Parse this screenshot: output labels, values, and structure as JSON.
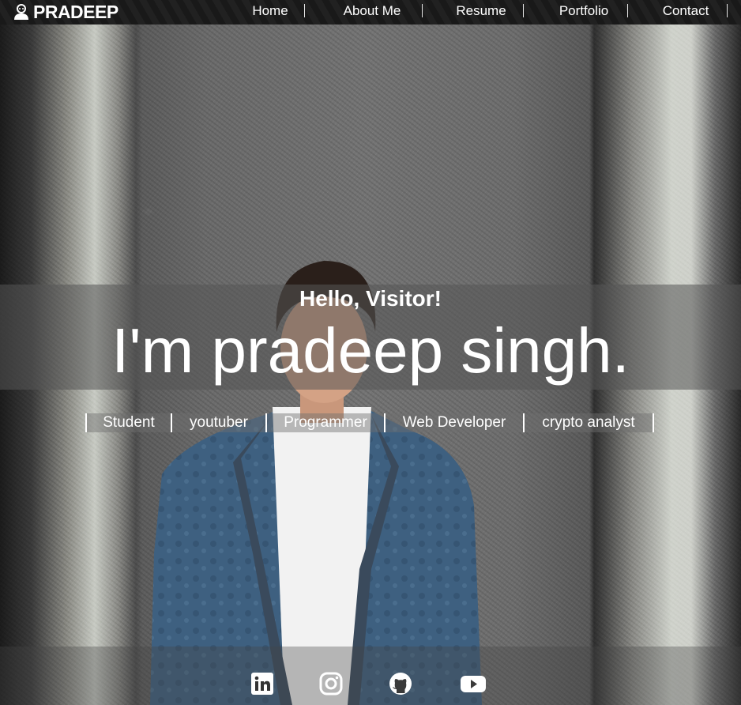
{
  "brand": {
    "name": "PRADEEP",
    "logo_icon": "user-avatar-icon"
  },
  "nav": {
    "items": [
      {
        "label": "Home"
      },
      {
        "label": "About Me"
      },
      {
        "label": "Resume"
      },
      {
        "label": "Portfolio"
      },
      {
        "label": "Contact"
      }
    ]
  },
  "hero": {
    "greeting": "Hello, Visitor!",
    "name": "I'm pradeep singh.",
    "roles": [
      "Student",
      "youtuber",
      "Programmer",
      "Web Developer",
      "crypto analyst"
    ]
  },
  "social": [
    {
      "icon": "linkedin-icon"
    },
    {
      "icon": "instagram-icon"
    },
    {
      "icon": "github-icon"
    },
    {
      "icon": "youtube-icon"
    }
  ]
}
